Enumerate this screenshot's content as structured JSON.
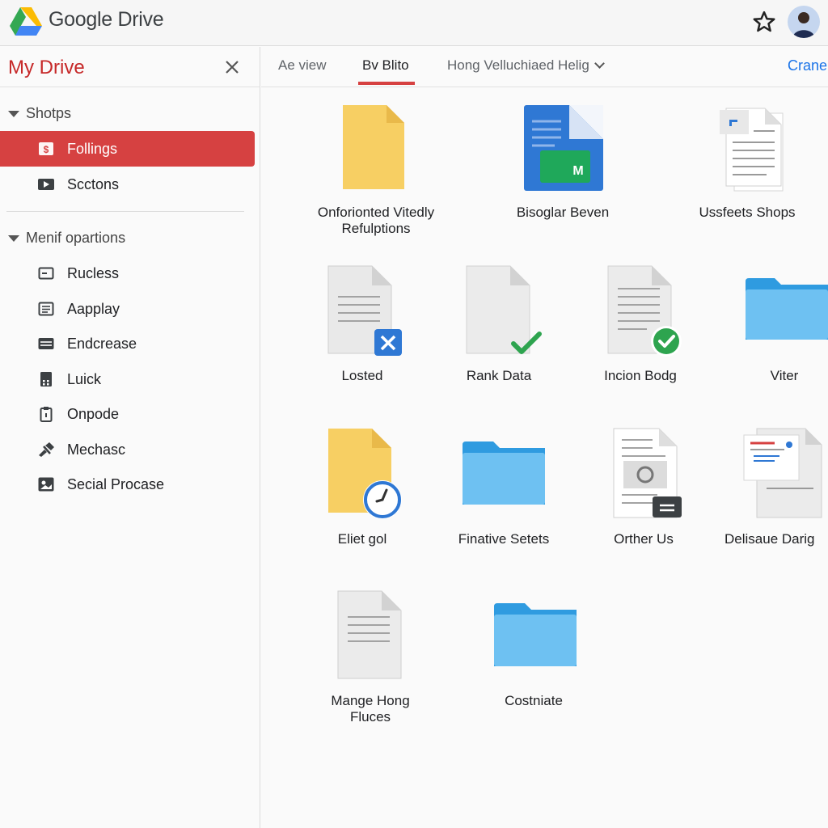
{
  "app": {
    "title": "Google Drive"
  },
  "sidebar": {
    "title": "My Drive",
    "section1": "Shotps",
    "items1": [
      {
        "label": "Follings"
      },
      {
        "label": "Scctons"
      }
    ],
    "section2": "Menif opartions",
    "items2": [
      {
        "label": "Rucless"
      },
      {
        "label": "Aapplay"
      },
      {
        "label": "Endcrease"
      },
      {
        "label": "Luick"
      },
      {
        "label": "Onpode"
      },
      {
        "label": "Mechasc"
      },
      {
        "label": "Secial Procase"
      }
    ]
  },
  "tabs": [
    {
      "label": "Ae view"
    },
    {
      "label": "Bv Blito"
    },
    {
      "label": "Hong Velluchiaed Helig"
    }
  ],
  "tab_link": "Crane",
  "files": [
    {
      "label": "Onforionted Vitedly",
      "label2": "Refulptions",
      "icon": "yellow-doc"
    },
    {
      "label": "Bisoglar Beven",
      "label2": "",
      "icon": "blue-doc"
    },
    {
      "label": "Ussfeets Shops",
      "label2": "",
      "icon": "doc-stack"
    },
    {
      "label": "Losted",
      "label2": "",
      "icon": "doc-x-badge"
    },
    {
      "label": "Rank Data",
      "label2": "",
      "icon": "doc-check"
    },
    {
      "label": "Incion Bodg",
      "label2": "",
      "icon": "doc-check-circle"
    },
    {
      "label": "Viter",
      "label2": "",
      "icon": "folder"
    },
    {
      "label": "Eliet gol",
      "label2": "",
      "icon": "yellow-doc-clock"
    },
    {
      "label": "Finative Setets",
      "label2": "",
      "icon": "folder"
    },
    {
      "label": "Orther Us",
      "label2": "",
      "icon": "doc-image"
    },
    {
      "label": "Delisaue Darig",
      "label2": "",
      "icon": "doc-pages"
    },
    {
      "label": "Mange Hong",
      "label2": "Fluces",
      "icon": "doc"
    },
    {
      "label": "Costniate",
      "label2": "",
      "icon": "folder"
    }
  ],
  "colors": {
    "accent": "#d64141",
    "title_red": "#c62828",
    "link": "#1a73e8",
    "folder": "#6ec1f2",
    "doc_yellow": "#f7cf63",
    "doc_blue": "#2f78d4"
  }
}
